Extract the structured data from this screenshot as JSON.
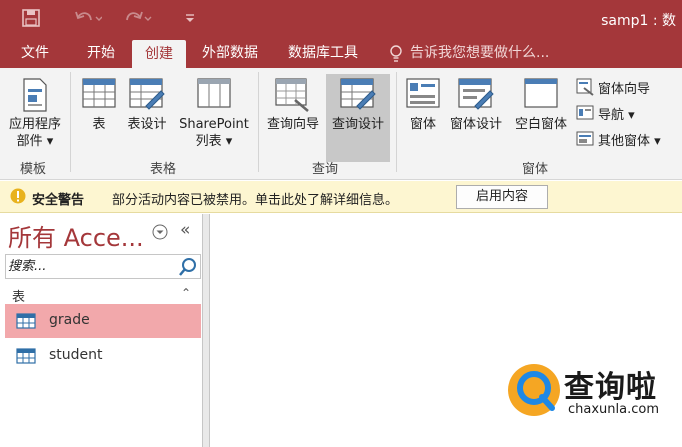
{
  "window": {
    "title": "samp1 : 数"
  },
  "tabs": [
    {
      "label": "文件"
    },
    {
      "label": "开始"
    },
    {
      "label": "创建"
    },
    {
      "label": "外部数据"
    },
    {
      "label": "数据库工具"
    }
  ],
  "tell_me": "告诉我您想要做什么...",
  "ribbon": {
    "groups": {
      "templates": "模板",
      "tables": "表格",
      "queries": "查询",
      "forms": "窗体"
    },
    "buttons": {
      "app_parts_line1": "应用程序",
      "app_parts_line2": "部件 ▾",
      "table": "表",
      "table_design": "表设计",
      "sharepoint_line1": "SharePoint",
      "sharepoint_line2": "列表 ▾",
      "query_wizard": "查询向导",
      "query_design": "查询设计",
      "form": "窗体",
      "form_design": "窗体设计",
      "blank_form": "空白窗体",
      "form_wizard": "窗体向导",
      "navigation": "导航 ▾",
      "more_forms": "其他窗体 ▾"
    }
  },
  "security": {
    "title": "安全警告",
    "message": "部分活动内容已被禁用。单击此处了解详细信息。",
    "enable_button": "启用内容"
  },
  "nav_pane": {
    "title": "所有 Acce...",
    "collapse": "«",
    "search_placeholder": "搜索...",
    "category": "表",
    "category_chevron": "⌃",
    "items": [
      {
        "label": "grade",
        "selected": true
      },
      {
        "label": "student",
        "selected": false
      }
    ]
  },
  "watermark": {
    "cn": "查询啦",
    "url": "chaxunla.com"
  },
  "colors": {
    "accent": "#a4373a",
    "ribbon_bg": "#f3f3f3",
    "warning_bg": "#fdf6d1",
    "selected_item": "#f2a8ab"
  }
}
